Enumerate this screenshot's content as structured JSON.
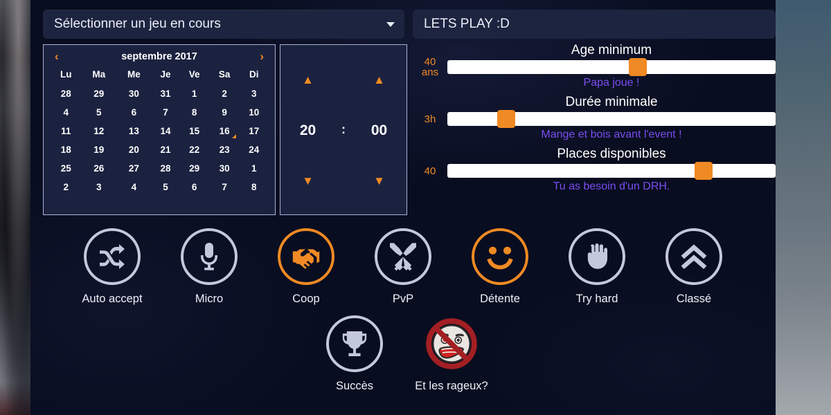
{
  "theme": {
    "accent": "#f08a24",
    "panel_bg": "#090d20",
    "card_bg": "#1b2240",
    "bar_bg": "#1d2440",
    "text": "#eceff8",
    "muted": "#6d7493",
    "sub_text": "#7b4df0",
    "icon_grey": "#c3c8da"
  },
  "topbar": {
    "select_label": "Sélectionner un jeu en cours",
    "select_caret_icon": "chevron-down-icon",
    "session_title": "LETS PLAY :D"
  },
  "calendar": {
    "prev_icon": "‹",
    "next_icon": "›",
    "month_title": "septembre 2017",
    "weekdays": [
      "Lu",
      "Ma",
      "Me",
      "Je",
      "Ve",
      "Sa",
      "Di"
    ],
    "weeks": [
      [
        {
          "d": "28",
          "state": "muted"
        },
        {
          "d": "29",
          "state": "muted"
        },
        {
          "d": "30",
          "state": "muted"
        },
        {
          "d": "31",
          "state": "muted"
        },
        {
          "d": "1",
          "state": "muted"
        },
        {
          "d": "2",
          "state": "muted"
        },
        {
          "d": "3",
          "state": "muted"
        }
      ],
      [
        {
          "d": "4",
          "state": "muted"
        },
        {
          "d": "5",
          "state": "muted"
        },
        {
          "d": "6",
          "state": "muted"
        },
        {
          "d": "7",
          "state": "muted"
        },
        {
          "d": "8",
          "state": "muted"
        },
        {
          "d": "9",
          "state": "muted"
        },
        {
          "d": "10",
          "state": "muted"
        }
      ],
      [
        {
          "d": "11",
          "state": "muted"
        },
        {
          "d": "12",
          "state": "muted"
        },
        {
          "d": "13",
          "state": "muted"
        },
        {
          "d": "14",
          "state": "muted"
        },
        {
          "d": "15",
          "state": "muted"
        },
        {
          "d": "16",
          "state": "marked"
        },
        {
          "d": "17",
          "state": "normal"
        }
      ],
      [
        {
          "d": "18",
          "state": "normal"
        },
        {
          "d": "19",
          "state": "normal"
        },
        {
          "d": "20",
          "state": "normal"
        },
        {
          "d": "21",
          "state": "normal"
        },
        {
          "d": "22",
          "state": "normal"
        },
        {
          "d": "23",
          "state": "normal"
        },
        {
          "d": "24",
          "state": "sel"
        }
      ],
      [
        {
          "d": "25",
          "state": "normal"
        },
        {
          "d": "26",
          "state": "normal"
        },
        {
          "d": "27",
          "state": "normal"
        },
        {
          "d": "28",
          "state": "normal"
        },
        {
          "d": "29",
          "state": "normal"
        },
        {
          "d": "30",
          "state": "normal"
        },
        {
          "d": "1",
          "state": "muted"
        }
      ],
      [
        {
          "d": "2",
          "state": "muted"
        },
        {
          "d": "3",
          "state": "muted"
        },
        {
          "d": "4",
          "state": "muted"
        },
        {
          "d": "5",
          "state": "muted"
        },
        {
          "d": "6",
          "state": "muted"
        },
        {
          "d": "7",
          "state": "muted"
        },
        {
          "d": "8",
          "state": "muted"
        }
      ]
    ]
  },
  "timepicker": {
    "hours": "20",
    "minutes": "00",
    "separator": ":",
    "up_icon": "chevron-up-icon",
    "down_icon": "chevron-down-icon"
  },
  "sliders": [
    {
      "label": "Age minimum",
      "value_line1": "40",
      "value_line2": "ans",
      "sub": "Papa joue !",
      "percent": 58
    },
    {
      "label": "Durée minimale",
      "value_line1": "3h",
      "value_line2": "",
      "sub": "Mange et bois avant l'event !",
      "percent": 18
    },
    {
      "label": "Places disponibles",
      "value_line1": "40",
      "value_line2": "",
      "sub": "Tu as besoin d'un DRH.",
      "percent": 78
    }
  ],
  "icons_row1": [
    {
      "label": "Auto accept",
      "icon": "shuffle-icon",
      "active": false
    },
    {
      "label": "Micro",
      "icon": "microphone-icon",
      "active": false
    },
    {
      "label": "Coop",
      "icon": "handshake-icon",
      "active": true
    },
    {
      "label": "PvP",
      "icon": "crossed-swords-icon",
      "active": false
    },
    {
      "label": "Détente",
      "icon": "smiley-icon",
      "active": true
    },
    {
      "label": "Try hard",
      "icon": "fist-icon",
      "active": false
    },
    {
      "label": "Classé",
      "icon": "double-chevron-up-icon",
      "active": false
    }
  ],
  "icons_row2": [
    {
      "label": "Succès",
      "icon": "trophy-icon",
      "active": false
    },
    {
      "label": "Et les rageux?",
      "icon": "no-rage-face-icon",
      "active": false
    }
  ]
}
